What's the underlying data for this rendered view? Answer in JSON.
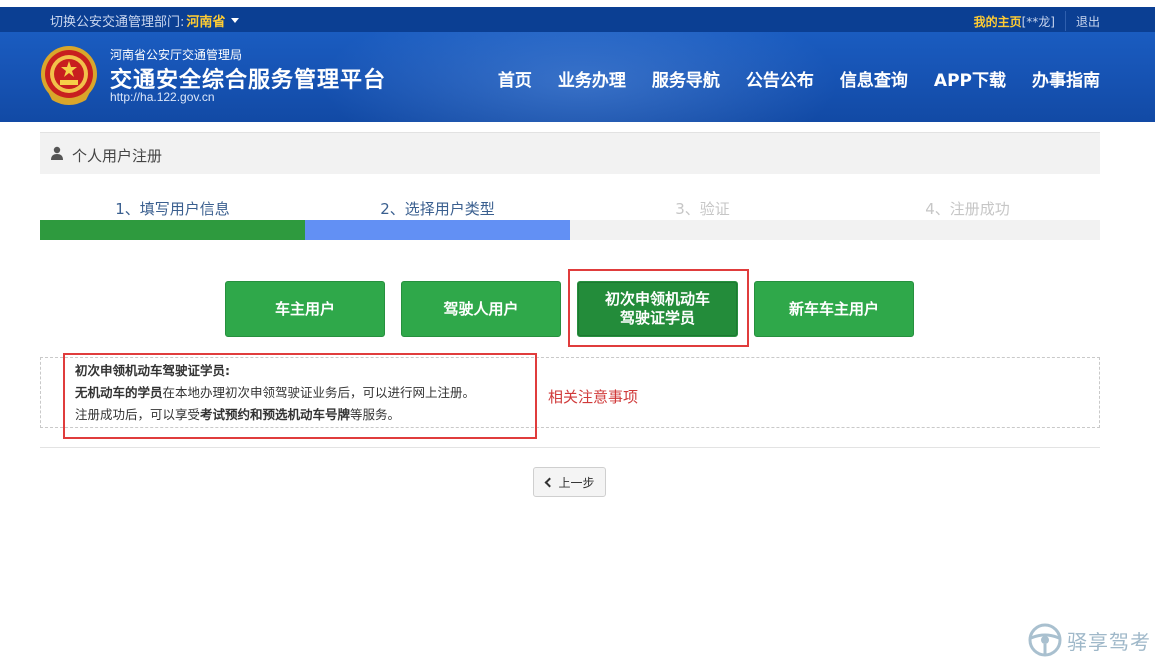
{
  "topbar": {
    "switch_label": "切换公安交通管理部门:",
    "province": "河南省",
    "home_label": "我的主页",
    "user": "[**龙]",
    "logout": "退出"
  },
  "header": {
    "org": "河南省公安厅交通管理局",
    "title": "交通安全综合服务管理平台",
    "url": "http://ha.122.gov.cn",
    "nav": [
      "首页",
      "业务办理",
      "服务导航",
      "公告公布",
      "信息查询",
      "APP下载",
      "办事指南"
    ]
  },
  "panel": {
    "title": "个人用户注册"
  },
  "steps": [
    {
      "label": "1、填写用户信息",
      "state": "done"
    },
    {
      "label": "2、选择用户类型",
      "state": "done"
    },
    {
      "label": "3、验证",
      "state": "todo"
    },
    {
      "label": "4、注册成功",
      "state": "todo"
    }
  ],
  "progress": {
    "completed_steps": 2,
    "total_steps": 4
  },
  "user_types": [
    {
      "line1": "车主用户",
      "line2": ""
    },
    {
      "line1": "驾驶人用户",
      "line2": ""
    },
    {
      "line1": "初次申领机动车",
      "line2": "驾驶证学员"
    },
    {
      "line1": "新车车主用户",
      "line2": ""
    }
  ],
  "info": {
    "heading": "初次申领机动车驾驶证学员:",
    "line1_bold": "无机动车的学员",
    "line1_rest": "在本地办理初次申领驾驶证业务后，可以进行网上注册。",
    "line2_pre": "注册成功后，可以享受",
    "line2_bold": "考试预约和预选机动车号牌",
    "line2_post": "等服务。"
  },
  "note": "相关注意事项",
  "prev_button": "上一步",
  "watermark": "驿享驾考",
  "colors": {
    "primary_blue": "#0b3f93",
    "button_green": "#2fa84a",
    "progress_green": "#2e9a3e",
    "progress_blue": "#6290f4",
    "highlight_red": "#e03c3c"
  }
}
